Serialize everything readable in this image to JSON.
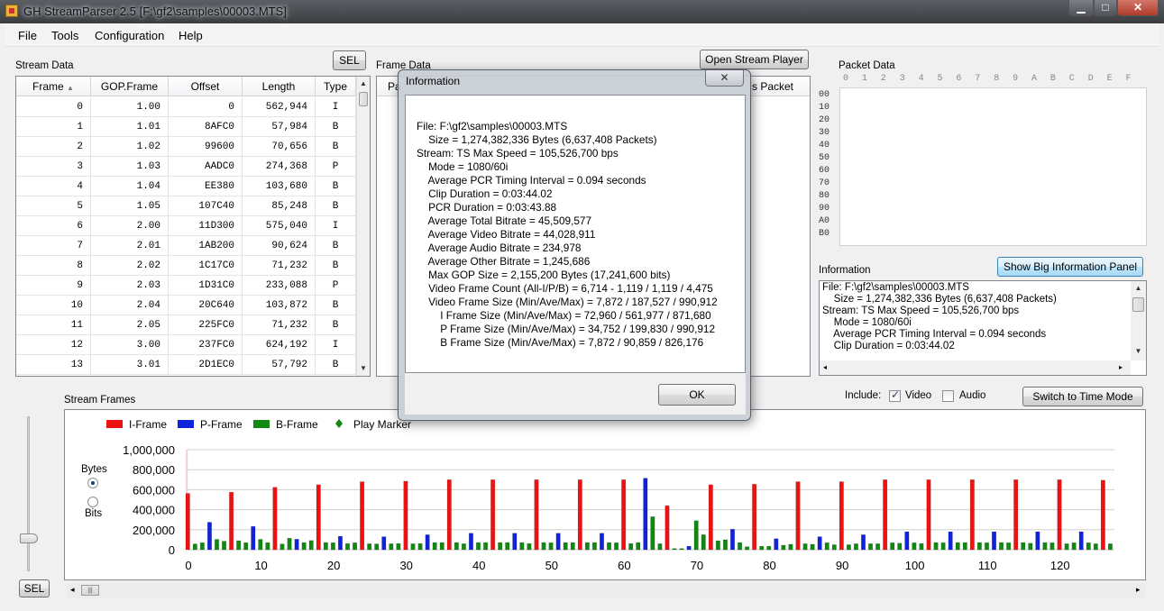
{
  "window": {
    "title": "GH StreamParser 2.5 [F:\\gf2\\samples\\00003.MTS]",
    "min_glyph": "▁",
    "max_glyph": "□",
    "close_glyph": "✕"
  },
  "menu": [
    "File",
    "Tools",
    "Configuration",
    "Help"
  ],
  "stream_data": {
    "label": "Stream Data",
    "sel_button": "SEL",
    "columns": [
      "Frame",
      "GOP.Frame",
      "Offset",
      "Length",
      "Type"
    ],
    "rows": [
      [
        "0",
        "1.00",
        "0",
        "562,944",
        "I"
      ],
      [
        "1",
        "1.01",
        "8AFC0",
        "57,984",
        "B"
      ],
      [
        "2",
        "1.02",
        "99600",
        "70,656",
        "B"
      ],
      [
        "3",
        "1.03",
        "AADC0",
        "274,368",
        "P"
      ],
      [
        "4",
        "1.04",
        "EE380",
        "103,680",
        "B"
      ],
      [
        "5",
        "1.05",
        "107C40",
        "85,248",
        "B"
      ],
      [
        "6",
        "2.00",
        "11D300",
        "575,040",
        "I"
      ],
      [
        "7",
        "2.01",
        "1AB200",
        "90,624",
        "B"
      ],
      [
        "8",
        "2.02",
        "1C17C0",
        "71,232",
        "B"
      ],
      [
        "9",
        "2.03",
        "1D31C0",
        "233,088",
        "P"
      ],
      [
        "10",
        "2.04",
        "20C640",
        "103,872",
        "B"
      ],
      [
        "11",
        "2.05",
        "225FC0",
        "71,232",
        "B"
      ],
      [
        "12",
        "3.00",
        "237FC0",
        "624,192",
        "I"
      ],
      [
        "13",
        "3.01",
        "2D1EC0",
        "57,792",
        "B"
      ]
    ]
  },
  "frame_data": {
    "label": "Frame Data",
    "open_player_button": "Open Stream Player",
    "col_first": "Pa",
    "col_last": "s Packet"
  },
  "packet_data": {
    "label": "Packet Data",
    "header_cols": [
      "0",
      "1",
      "2",
      "3",
      "4",
      "5",
      "6",
      "7",
      "8",
      "9",
      "A",
      "B",
      "C",
      "D",
      "E",
      "F"
    ],
    "row_labels": [
      "00",
      "10",
      "20",
      "30",
      "40",
      "50",
      "60",
      "70",
      "80",
      "90",
      "A0",
      "B0"
    ]
  },
  "information_panel": {
    "label": "Information",
    "show_big_button": "Show Big Information Panel",
    "lines": [
      "File: F:\\gf2\\samples\\00003.MTS",
      "    Size = 1,274,382,336 Bytes (6,637,408 Packets)",
      "Stream: TS Max Speed = 105,526,700 bps",
      "    Mode = 1080/60i",
      "    Average PCR Timing Interval = 0.094 seconds",
      "    Clip Duration = 0:03:44.02"
    ]
  },
  "dialog": {
    "title": "Information",
    "ok_button": "OK",
    "lines": [
      "File: F:\\gf2\\samples\\00003.MTS",
      "    Size = 1,274,382,336 Bytes (6,637,408 Packets)",
      "Stream: TS Max Speed = 105,526,700 bps",
      "    Mode = 1080/60i",
      "    Average PCR Timing Interval = 0.094 seconds",
      "    Clip Duration = 0:03:44.02",
      "    PCR Duration = 0:03:43.88",
      "    Average Total Bitrate = 45,509,577",
      "    Average Video Bitrate = 44,028,911",
      "    Average Audio Bitrate = 234,978",
      "    Average Other Bitrate = 1,245,686",
      "    Max GOP Size = 2,155,200 Bytes (17,241,600 bits)",
      "    Video Frame Count (All-I/P/B) = 6,714 - 1,119 / 1,119 / 4,475",
      "    Video Frame Size (Min/Ave/Max) = 7,872 / 187,527 / 990,912",
      "        I Frame Size (Min/Ave/Max) = 72,960 / 561,977 / 871,680",
      "        P Frame Size (Min/Ave/Max) = 34,752 / 199,830 / 990,912",
      "        B Frame Size (Min/Ave/Max) = 7,872 / 90,859 / 826,176"
    ]
  },
  "stream_frames": {
    "label": "Stream Frames",
    "include_label": "Include:",
    "video_label": "Video",
    "video_checked": true,
    "audio_label": "Audio",
    "audio_checked": false,
    "switch_button": "Switch to Time Mode",
    "units_label": "Bytes",
    "bits_label": "Bits",
    "unit_selected": "Bytes",
    "sel_button": "SEL",
    "scroll_thumb_glyph": "|||",
    "left_arrow": "◂",
    "right_arrow": "▸"
  },
  "chart_data": {
    "type": "bar",
    "legend": [
      {
        "name": "I-Frame",
        "color": "#ee1111"
      },
      {
        "name": "P-Frame",
        "color": "#1122dd"
      },
      {
        "name": "B-Frame",
        "color": "#118811"
      },
      {
        "name": "Play Marker",
        "color": "#118811"
      }
    ],
    "yticks": [
      "1,000,000",
      "800,000",
      "600,000",
      "400,000",
      "200,000",
      "0"
    ],
    "ylim": [
      0,
      1000000
    ],
    "xticks": [
      "0",
      "10",
      "20",
      "30",
      "40",
      "50",
      "60",
      "70",
      "80",
      "90",
      "100",
      "110",
      "120"
    ],
    "xlim": [
      0,
      127
    ],
    "grid": true,
    "series_frames": [
      [
        0,
        "I",
        562944
      ],
      [
        1,
        "B",
        57984
      ],
      [
        2,
        "B",
        70656
      ],
      [
        3,
        "P",
        274368
      ],
      [
        4,
        "B",
        103680
      ],
      [
        5,
        "B",
        85248
      ],
      [
        6,
        "I",
        575040
      ],
      [
        7,
        "B",
        90624
      ],
      [
        8,
        "B",
        71232
      ],
      [
        9,
        "P",
        233088
      ],
      [
        10,
        "B",
        103872
      ],
      [
        11,
        "B",
        71232
      ],
      [
        12,
        "I",
        624192
      ],
      [
        13,
        "B",
        57792
      ],
      [
        14,
        "B",
        115000
      ],
      [
        15,
        "P",
        105000
      ],
      [
        16,
        "B",
        72000
      ],
      [
        17,
        "B",
        92000
      ],
      [
        18,
        "I",
        650000
      ],
      [
        19,
        "B",
        72000
      ],
      [
        20,
        "B",
        70000
      ],
      [
        21,
        "P",
        135000
      ],
      [
        22,
        "B",
        62000
      ],
      [
        23,
        "B",
        70000
      ],
      [
        24,
        "I",
        680000
      ],
      [
        25,
        "B",
        60000
      ],
      [
        26,
        "B",
        58000
      ],
      [
        27,
        "P",
        130000
      ],
      [
        28,
        "B",
        60000
      ],
      [
        29,
        "B",
        62000
      ],
      [
        30,
        "I",
        685000
      ],
      [
        31,
        "B",
        60000
      ],
      [
        32,
        "B",
        62000
      ],
      [
        33,
        "P",
        150000
      ],
      [
        34,
        "B",
        72000
      ],
      [
        35,
        "B",
        72000
      ],
      [
        36,
        "I",
        700000
      ],
      [
        37,
        "B",
        72000
      ],
      [
        38,
        "B",
        60000
      ],
      [
        39,
        "P",
        165000
      ],
      [
        40,
        "B",
        72000
      ],
      [
        41,
        "B",
        72000
      ],
      [
        42,
        "I",
        700000
      ],
      [
        43,
        "B",
        72000
      ],
      [
        44,
        "B",
        72000
      ],
      [
        45,
        "P",
        165000
      ],
      [
        46,
        "B",
        72000
      ],
      [
        47,
        "B",
        62000
      ],
      [
        48,
        "I",
        700000
      ],
      [
        49,
        "B",
        72000
      ],
      [
        50,
        "B",
        70000
      ],
      [
        51,
        "P",
        165000
      ],
      [
        52,
        "B",
        72000
      ],
      [
        53,
        "B",
        72000
      ],
      [
        54,
        "I",
        700000
      ],
      [
        55,
        "B",
        72000
      ],
      [
        56,
        "B",
        72000
      ],
      [
        57,
        "P",
        165000
      ],
      [
        58,
        "B",
        72000
      ],
      [
        59,
        "B",
        70000
      ],
      [
        60,
        "I",
        700000
      ],
      [
        61,
        "B",
        62000
      ],
      [
        62,
        "B",
        72000
      ],
      [
        63,
        "P",
        715000
      ],
      [
        64,
        "B",
        330000
      ],
      [
        65,
        "B",
        60000
      ],
      [
        66,
        "I",
        440000
      ],
      [
        67,
        "B",
        12000
      ],
      [
        68,
        "B",
        12000
      ],
      [
        69,
        "P",
        35000
      ],
      [
        70,
        "B",
        290000
      ],
      [
        71,
        "B",
        150000
      ],
      [
        72,
        "I",
        650000
      ],
      [
        73,
        "B",
        90000
      ],
      [
        74,
        "B",
        100000
      ],
      [
        75,
        "P",
        205000
      ],
      [
        76,
        "B",
        72000
      ],
      [
        77,
        "B",
        30000
      ],
      [
        78,
        "I",
        655000
      ],
      [
        79,
        "B",
        35000
      ],
      [
        80,
        "B",
        35000
      ],
      [
        81,
        "P",
        110000
      ],
      [
        82,
        "B",
        45000
      ],
      [
        83,
        "B",
        55000
      ],
      [
        84,
        "I",
        680000
      ],
      [
        85,
        "B",
        60000
      ],
      [
        86,
        "B",
        55000
      ],
      [
        87,
        "P",
        130000
      ],
      [
        88,
        "B",
        70000
      ],
      [
        89,
        "B",
        50000
      ],
      [
        90,
        "I",
        680000
      ],
      [
        91,
        "B",
        50000
      ],
      [
        92,
        "B",
        60000
      ],
      [
        93,
        "P",
        150000
      ],
      [
        94,
        "B",
        60000
      ],
      [
        95,
        "B",
        60000
      ],
      [
        96,
        "I",
        700000
      ],
      [
        97,
        "B",
        70000
      ],
      [
        98,
        "B",
        65000
      ],
      [
        99,
        "P",
        180000
      ],
      [
        100,
        "B",
        70000
      ],
      [
        101,
        "B",
        62000
      ],
      [
        102,
        "I",
        700000
      ],
      [
        103,
        "B",
        72000
      ],
      [
        104,
        "B",
        70000
      ],
      [
        105,
        "P",
        180000
      ],
      [
        106,
        "B",
        72000
      ],
      [
        107,
        "B",
        72000
      ],
      [
        108,
        "I",
        700000
      ],
      [
        109,
        "B",
        72000
      ],
      [
        110,
        "B",
        70000
      ],
      [
        111,
        "P",
        180000
      ],
      [
        112,
        "B",
        72000
      ],
      [
        113,
        "B",
        70000
      ],
      [
        114,
        "I",
        700000
      ],
      [
        115,
        "B",
        72000
      ],
      [
        116,
        "B",
        65000
      ],
      [
        117,
        "P",
        180000
      ],
      [
        118,
        "B",
        72000
      ],
      [
        119,
        "B",
        70000
      ],
      [
        120,
        "I",
        700000
      ],
      [
        121,
        "B",
        60000
      ],
      [
        122,
        "B",
        70000
      ],
      [
        123,
        "P",
        180000
      ],
      [
        124,
        "B",
        70000
      ],
      [
        125,
        "B",
        60000
      ],
      [
        126,
        "I",
        695000
      ],
      [
        127,
        "B",
        60000
      ]
    ]
  }
}
